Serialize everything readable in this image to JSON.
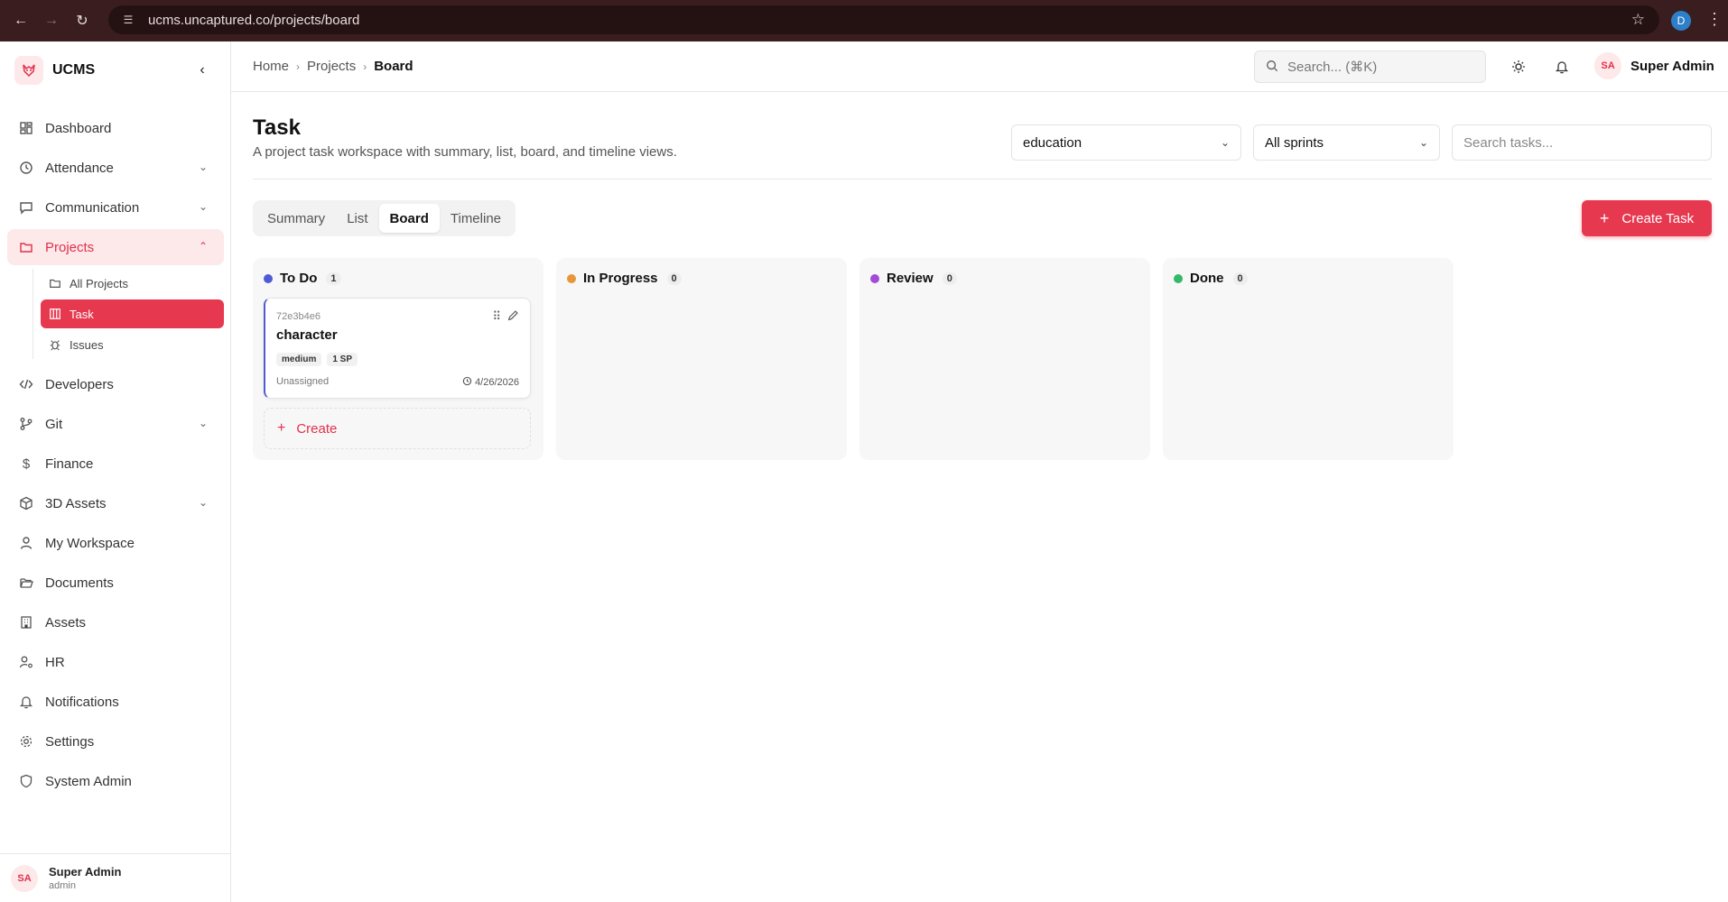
{
  "browser": {
    "url": "ucms.uncaptured.co/projects/board",
    "profile_initial": "D"
  },
  "brand": {
    "name": "UCMS"
  },
  "sidebar": {
    "items": [
      {
        "label": "Dashboard",
        "icon": "dashboard-icon",
        "chevron": false
      },
      {
        "label": "Attendance",
        "icon": "clock-icon",
        "chevron": true
      },
      {
        "label": "Communication",
        "icon": "message-icon",
        "chevron": true
      },
      {
        "label": "Projects",
        "icon": "folder-icon",
        "chevron": true,
        "active": true
      }
    ],
    "project_sub": [
      {
        "label": "All Projects",
        "icon": "folder-icon"
      },
      {
        "label": "Task",
        "icon": "board-icon",
        "active": true
      },
      {
        "label": "Issues",
        "icon": "bug-icon"
      }
    ],
    "items_after": [
      {
        "label": "Developers",
        "icon": "code-icon",
        "chevron": false
      },
      {
        "label": "Git",
        "icon": "git-branch-icon",
        "chevron": true
      },
      {
        "label": "Finance",
        "icon": "dollar-icon",
        "chevron": false
      },
      {
        "label": "3D Assets",
        "icon": "cube-icon",
        "chevron": true
      },
      {
        "label": "My Workspace",
        "icon": "user-icon",
        "chevron": false
      },
      {
        "label": "Documents",
        "icon": "folder-open-icon",
        "chevron": false
      },
      {
        "label": "Assets",
        "icon": "building-icon",
        "chevron": false
      },
      {
        "label": "HR",
        "icon": "user-cog-icon",
        "chevron": false
      },
      {
        "label": "Notifications",
        "icon": "bell-icon",
        "chevron": false
      },
      {
        "label": "Settings",
        "icon": "gear-icon",
        "chevron": false
      },
      {
        "label": "System Admin",
        "icon": "shield-icon",
        "chevron": false
      }
    ],
    "footer": {
      "initials": "SA",
      "name": "Super Admin",
      "role": "admin"
    }
  },
  "header": {
    "breadcrumb": [
      "Home",
      "Projects",
      "Board"
    ],
    "search_placeholder": "Search... (⌘K)",
    "user_initials": "SA",
    "user_name": "Super Admin"
  },
  "page": {
    "title": "Task",
    "subtitle": "A project task workspace with summary, list, board, and timeline views.",
    "project_select": "education",
    "sprint_select": "All sprints",
    "task_search_placeholder": "Search tasks...",
    "tabs": [
      "Summary",
      "List",
      "Board",
      "Timeline"
    ],
    "active_tab": "Board",
    "create_task_label": "Create Task"
  },
  "board": {
    "columns": [
      {
        "title": "To Do",
        "count": "1",
        "color": "#4f5bd5"
      },
      {
        "title": "In Progress",
        "count": "0",
        "color": "#e9963a"
      },
      {
        "title": "Review",
        "count": "0",
        "color": "#a34bd6"
      },
      {
        "title": "Done",
        "count": "0",
        "color": "#34b86a"
      }
    ],
    "card": {
      "id": "72e3b4e6",
      "title": "character",
      "priority": "medium",
      "points": "1 SP",
      "assignee": "Unassigned",
      "date": "4/26/2026"
    },
    "create_label": "Create"
  },
  "colors": {
    "accent": "#e63950",
    "accent_light": "#fde8ea"
  }
}
